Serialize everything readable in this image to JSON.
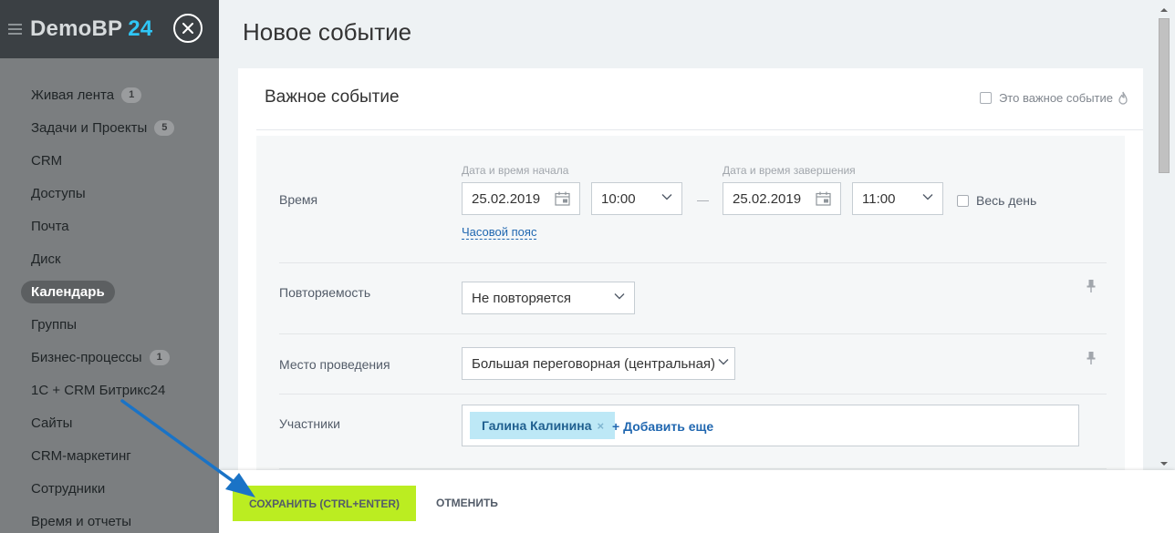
{
  "sidebar": {
    "logo_text": "DemoBP",
    "logo_number": "24",
    "items": [
      {
        "label": "Живая лента",
        "badge": "1"
      },
      {
        "label": "Задачи и Проекты",
        "badge": "5"
      },
      {
        "label": "CRM",
        "badge": ""
      },
      {
        "label": "Доступы",
        "badge": ""
      },
      {
        "label": "Почта",
        "badge": ""
      },
      {
        "label": "Диск",
        "badge": ""
      },
      {
        "label": "Календарь",
        "badge": "",
        "active": true
      },
      {
        "label": "Группы",
        "badge": ""
      },
      {
        "label": "Бизнес-процессы",
        "badge": "1"
      },
      {
        "label": "1С + CRM Битрикс24",
        "badge": ""
      },
      {
        "label": "Сайты",
        "badge": ""
      },
      {
        "label": "CRM-маркетинг",
        "badge": ""
      },
      {
        "label": "Сотрудники",
        "badge": ""
      },
      {
        "label": "Время и отчеты",
        "badge": ""
      }
    ]
  },
  "slider": {
    "title": "Новое событие",
    "event_name": "Важное событие",
    "important_label": "Это важное событие"
  },
  "form": {
    "time": {
      "label": "Время",
      "start_caption": "Дата и время начала",
      "end_caption": "Дата и время завершения",
      "start_date": "25.02.2019",
      "start_time": "10:00",
      "end_date": "25.02.2019",
      "end_time": "11:00",
      "separator": "—",
      "timezone_link": "Часовой пояс",
      "all_day_label": "Весь день"
    },
    "repeat": {
      "label": "Повторяемость",
      "value": "Не повторяется"
    },
    "location": {
      "label": "Место проведения",
      "value": "Большая переговорная (центральная)"
    },
    "attendees": {
      "label": "Участники",
      "chip": "Галина Калинина",
      "chip_remove": "×",
      "add_more": "+ Добавить еще"
    }
  },
  "footer": {
    "save_label": "СОХРАНИТЬ (CTRL+ENTER)",
    "cancel_label": "ОТМЕНИТЬ"
  },
  "colors": {
    "save_button": "#bbed21",
    "annotation_arrow": "#1a73c6",
    "logo_accent": "#2fc6f6"
  }
}
